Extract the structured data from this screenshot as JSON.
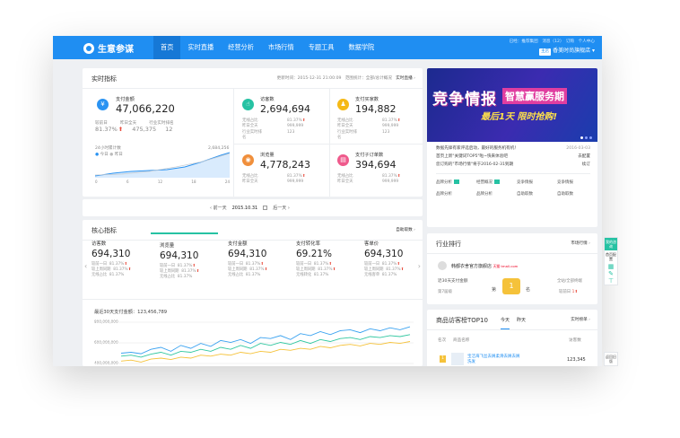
{
  "topbar": {
    "logo": "生意参谋",
    "nav": [
      "首页",
      "实时直播",
      "经营分析",
      "市场行情",
      "专题工具",
      "数据学院"
    ],
    "right_links": "已经：推荐集团　消息（12）　订购　个人中心",
    "shop_badge": "主店",
    "shop_name": "香美时尚旗舰店"
  },
  "realtime": {
    "title": "实时指标",
    "meta_time": "更新时间：2015-12-31 21:00:09",
    "meta_range": "范围统计：全部/总计概况",
    "live_link": "实时直播",
    "pay_amount_label": "支付金额",
    "pay_amount_value": "47,066,220",
    "yesterday_label": "较前日",
    "yesterday_value": "81.37%",
    "prev_full_label": "昨日全天",
    "prev_full_value": "475,375",
    "industry_label": "行业实时排名",
    "industry_value": "12",
    "chart_title": "24小时累计数",
    "chart_legend_today": "今日",
    "chart_legend_yesterday": "昨日",
    "chart_ymax": "2,684,256",
    "chart_ticks": [
      "0",
      "6",
      "12",
      "18",
      "24"
    ],
    "metrics": [
      {
        "name": "访客数",
        "value": "2,694,694",
        "rows": [
          [
            "无线占比",
            "81.37%"
          ],
          [
            "昨日全天",
            "999,999"
          ],
          [
            "行业实时排名",
            "123"
          ]
        ]
      },
      {
        "name": "支付买家数",
        "value": "194,882",
        "rows": [
          [
            "无线占比",
            "81.37%"
          ],
          [
            "昨日全天",
            "999,999"
          ],
          [
            "行业实时排名",
            "123"
          ]
        ]
      },
      {
        "name": "浏览量",
        "value": "4,778,243",
        "rows": [
          [
            "无线占比",
            "81.37%"
          ],
          [
            "昨日全天",
            "999,999"
          ]
        ]
      },
      {
        "name": "支付子订单数",
        "value": "394,694",
        "rows": [
          [
            "无线占比",
            "81.37%"
          ],
          [
            "昨日全天",
            "999,999"
          ]
        ]
      }
    ],
    "date_prev": "前一天",
    "date_value": "2015.10.31",
    "date_next": "后一天"
  },
  "core": {
    "title": "核心指标",
    "link": "自助取数",
    "tabs": [
      {
        "name": "访客数",
        "value": "694,310",
        "rows": [
          "较前一日",
          "较上周同期",
          "无线占比"
        ]
      },
      {
        "name": "浏览量",
        "value": "694,310",
        "rows": [
          "较前一日",
          "较上周同期",
          "无线占比"
        ]
      },
      {
        "name": "支付金额",
        "value": "694,310",
        "rows": [
          "较前一日",
          "较上周同期",
          "无线占比"
        ]
      },
      {
        "name": "支付转化率",
        "value": "69.21%",
        "rows": [
          "较前一日",
          "较上周同期",
          "无线转化"
        ]
      },
      {
        "name": "客单价",
        "value": "694,310",
        "rows": [
          "较前一日",
          "较上周同期",
          "无线客单"
        ]
      }
    ],
    "rate": "81.37%",
    "trend_title": "最近30天支付金额：123,456,789",
    "trend_y": [
      "800,000,000",
      "600,000,000",
      "400,000,000"
    ]
  },
  "chart_data": {
    "type": "line",
    "title": "最近30天支付金额：123,456,789",
    "ylim": [
      300000000,
      850000000
    ],
    "series": [
      {
        "name": "blue",
        "values": [
          460,
          470,
          455,
          500,
          520,
          480,
          540,
          510,
          560,
          530,
          590,
          570,
          600,
          560,
          620,
          610,
          640,
          600,
          660,
          640,
          680,
          650,
          690,
          700,
          670,
          710,
          690,
          720,
          700,
          730
        ]
      },
      {
        "name": "teal",
        "values": [
          430,
          440,
          420,
          450,
          470,
          440,
          480,
          470,
          500,
          480,
          520,
          500,
          540,
          510,
          560,
          540,
          570,
          550,
          590,
          560,
          600,
          580,
          610,
          620,
          600,
          630,
          620,
          640,
          630,
          650
        ]
      },
      {
        "name": "yellow",
        "values": [
          380,
          390,
          370,
          400,
          410,
          395,
          420,
          410,
          440,
          430,
          450,
          440,
          470,
          455,
          480,
          470,
          500,
          490,
          510,
          500,
          530,
          515,
          540,
          550,
          535,
          560,
          550,
          570,
          560,
          580
        ]
      }
    ],
    "colors": {
      "blue": "#3aa2f0",
      "teal": "#30c7a0",
      "yellow": "#f5c23a"
    }
  },
  "banner": {
    "headline": "竞争情报",
    "tag": "智慧赢服务期",
    "sub": "最后1天 限时抢购!"
  },
  "news": [
    {
      "text": "数据先锋有家评选启动，最好的服务机有机！",
      "date": "2016-03-03"
    },
    {
      "text": "首页上新\"关键词TOP5\"啦~快来体验吧",
      "date": "去配置"
    },
    {
      "text": "您订购的\"市场行情\"将于2016-02-31到期",
      "date": "续订"
    }
  ],
  "shortcuts": [
    "品牌分析",
    "经营概况",
    "竞争情报",
    "竞争情报",
    "品牌分析",
    "品牌分析",
    "自助取数",
    "自助取数"
  ],
  "industry": {
    "title": "行业排行",
    "link": "市场行情",
    "shop": "韩都衣舍官方旗舰店",
    "shop_tag": "天猫 tmall.com",
    "scope": "全站/全部终端",
    "row_label": "近30天支付金额",
    "rank_word": "第",
    "rank_unit": "名",
    "sub_left": "第7届级",
    "sub_right": "较前日",
    "rank_number": "1"
  },
  "top10": {
    "title": "商品访客榜TOP10",
    "tabs": [
      "今天",
      "昨天"
    ],
    "link": "实时榜单",
    "col_rank": "名次",
    "col_name": "商品名称",
    "col_visits": "访客数",
    "row_rank": "1",
    "row_name": "宝洁海飞丝去屑柔滑去屑去屑洗发",
    "row_visits": "123,345"
  },
  "side": {
    "a": "我的咨询",
    "b": "首页配置",
    "c": "返回旧版"
  }
}
